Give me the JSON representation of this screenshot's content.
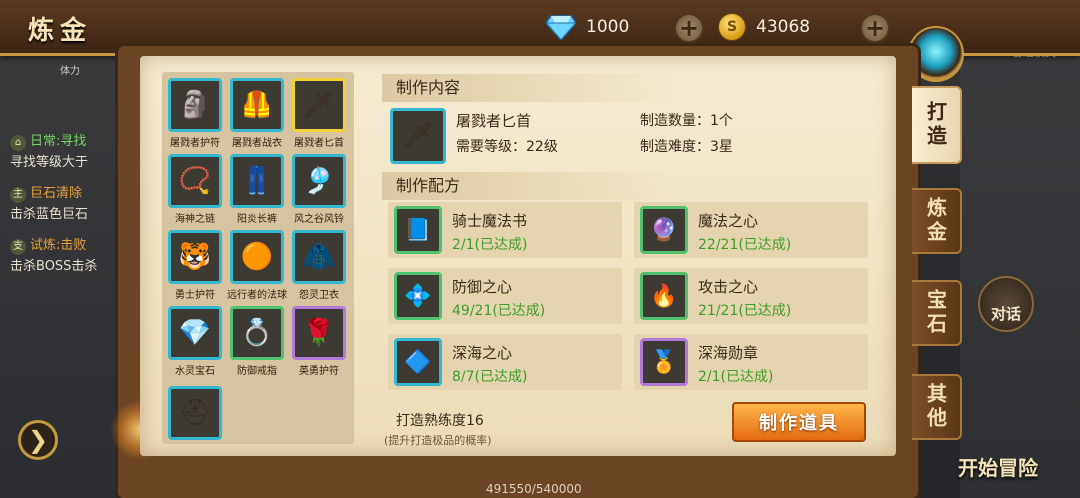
{
  "header": {
    "title": "炼金",
    "gems": "1000",
    "gold": "43068"
  },
  "left_quests": [
    {
      "tag": "⌂",
      "title": "日常:寻找",
      "desc": "寻找等级大于"
    },
    {
      "tag": "主",
      "title": "巨石清除",
      "desc": "击杀蓝色巨石"
    },
    {
      "tag": "支",
      "title": "试炼:击败",
      "desc": "击杀BOSS击杀"
    }
  ],
  "left_small": "体力",
  "items": [
    {
      "label": "屠戮者护符",
      "icon": "🗿",
      "color": "blue"
    },
    {
      "label": "屠戮者战衣",
      "icon": "🦺",
      "color": "blue"
    },
    {
      "label": "屠戮者匕首",
      "icon": "🗡",
      "color": "sel"
    },
    {
      "label": "海神之链",
      "icon": "📿",
      "color": "blue"
    },
    {
      "label": "阳炎长裤",
      "icon": "👖",
      "color": "blue"
    },
    {
      "label": "风之谷风铃",
      "icon": "🎐",
      "color": "blue"
    },
    {
      "label": "勇士护符",
      "icon": "🐯",
      "color": "blue"
    },
    {
      "label": "远行者的法球",
      "icon": "🟠",
      "color": "blue"
    },
    {
      "label": "怨灵卫衣",
      "icon": "🧥",
      "color": "blue"
    },
    {
      "label": "水灵宝石",
      "icon": "💎",
      "color": "blue"
    },
    {
      "label": "防御戒指",
      "icon": "💍",
      "color": "green"
    },
    {
      "label": "英勇护符",
      "icon": "🌹",
      "color": "purple"
    },
    {
      "label": "",
      "icon": "⛑",
      "color": "blue"
    }
  ],
  "content": {
    "heading": "制作内容",
    "item_name": "屠戮者匕首",
    "level_req": "需要等级：22级",
    "count": "制造数量：1个",
    "difficulty": "制造难度：3星",
    "item_icon": "🗡"
  },
  "recipe": {
    "heading": "制作配方",
    "materials": [
      {
        "name": "骑士魔法书",
        "count": "2/1(已达成)",
        "icon": "📘",
        "color": "green"
      },
      {
        "name": "魔法之心",
        "count": "22/21(已达成)",
        "icon": "🔮",
        "color": "green"
      },
      {
        "name": "防御之心",
        "count": "49/21(已达成)",
        "icon": "💠",
        "color": "green"
      },
      {
        "name": "攻击之心",
        "count": "21/21(已达成)",
        "icon": "🔥",
        "color": "green"
      },
      {
        "name": "深海之心",
        "count": "8/7(已达成)",
        "icon": "🔷",
        "color": "blue"
      },
      {
        "name": "深海勋章",
        "count": "2/1(已达成)",
        "icon": "🏅",
        "color": "purple"
      }
    ]
  },
  "proficiency": "打造熟练度16",
  "proficiency_note": "(提升打造极品的概率)",
  "make_button": "制作道具",
  "tabs": [
    "打造",
    "炼金",
    "宝石",
    "其他"
  ],
  "right": {
    "city": "主城",
    "road": "之路",
    "mode": "普通模式",
    "talk": "对话",
    "start": "开始冒险"
  },
  "exp": "491550/540000"
}
